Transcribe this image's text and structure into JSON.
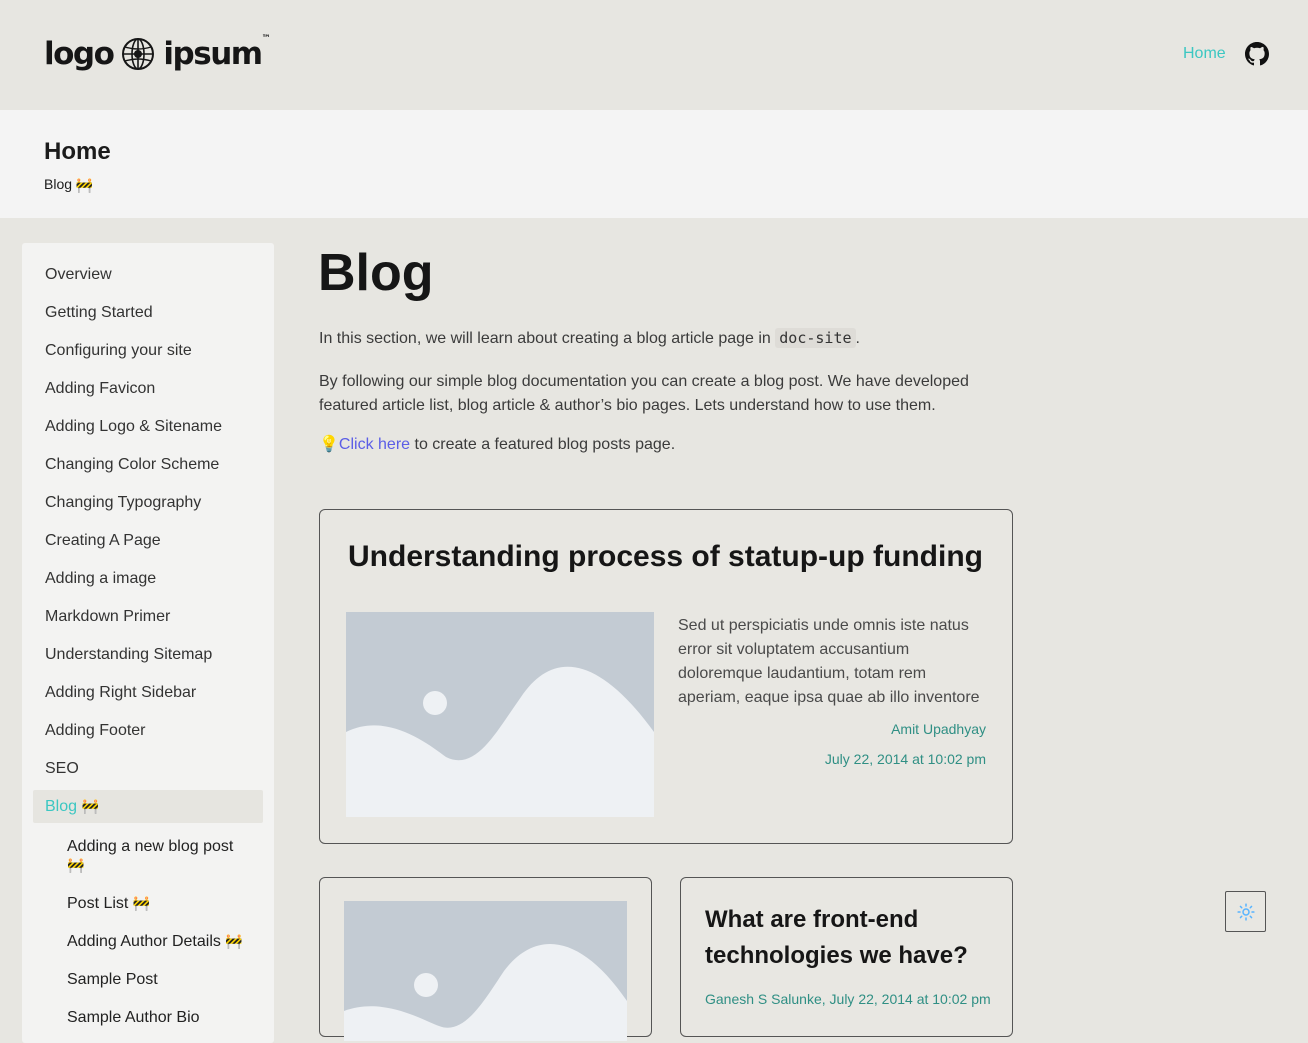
{
  "header": {
    "logo_left": "logo",
    "logo_right": "ipsum",
    "logo_tm": "™",
    "nav_home": "Home",
    "github_icon": "github-icon",
    "accent": "#3cc7c2"
  },
  "hero": {
    "title": "Home",
    "crumb": "Blog",
    "crumb_icon": "🚧"
  },
  "sidebar": {
    "items": [
      {
        "label": "Overview"
      },
      {
        "label": "Getting Started"
      },
      {
        "label": "Configuring your site"
      },
      {
        "label": "Adding Favicon"
      },
      {
        "label": "Adding Logo & Sitename"
      },
      {
        "label": "Changing Color Scheme"
      },
      {
        "label": "Changing Typography"
      },
      {
        "label": "Creating A Page"
      },
      {
        "label": "Adding a image"
      },
      {
        "label": "Markdown Primer"
      },
      {
        "label": "Understanding Sitemap"
      },
      {
        "label": "Adding Right Sidebar"
      },
      {
        "label": "Adding Footer"
      },
      {
        "label": "SEO"
      }
    ],
    "active": {
      "label": "Blog",
      "icon": "🚧"
    },
    "subitems": [
      {
        "label_line1": "Adding a new blog post",
        "icon": "🚧"
      },
      {
        "label": "Post List",
        "icon": "🚧"
      },
      {
        "label": "Adding Author Details",
        "icon": "🚧"
      },
      {
        "label": "Sample Post"
      },
      {
        "label": "Sample Author Bio"
      }
    ]
  },
  "main": {
    "title": "Blog",
    "intro_before": "In this section, we will learn about creating a blog article page in ",
    "intro_code": "doc-site",
    "intro_after": ".",
    "para2": "By following our simple blog documentation you can create a blog post. We have developed featured article list, blog article & author’s bio pages. Lets understand how to use them.",
    "tip_icon": "💡",
    "tip_link": "Click here",
    "tip_text": " to create a featured blog posts page."
  },
  "cards": {
    "featured": {
      "title": "Understanding process of statup-up funding",
      "excerpt": "Sed ut perspiciatis unde omnis iste natus error sit voluptatem accusantium doloremque laudantium, totam rem aperiam, eaque ipsa quae ab illo inventore",
      "author": "Amit Upadhyay",
      "date": "July 22, 2014 at 10:02 pm"
    },
    "second": {
      "title": "What are front-end technologies we have?",
      "author": "Ganesh S Salunke",
      "date": "July 22, 2014 at 10:02 pm",
      "separator": ", "
    }
  },
  "theme_toggle_icon": "sun-icon"
}
